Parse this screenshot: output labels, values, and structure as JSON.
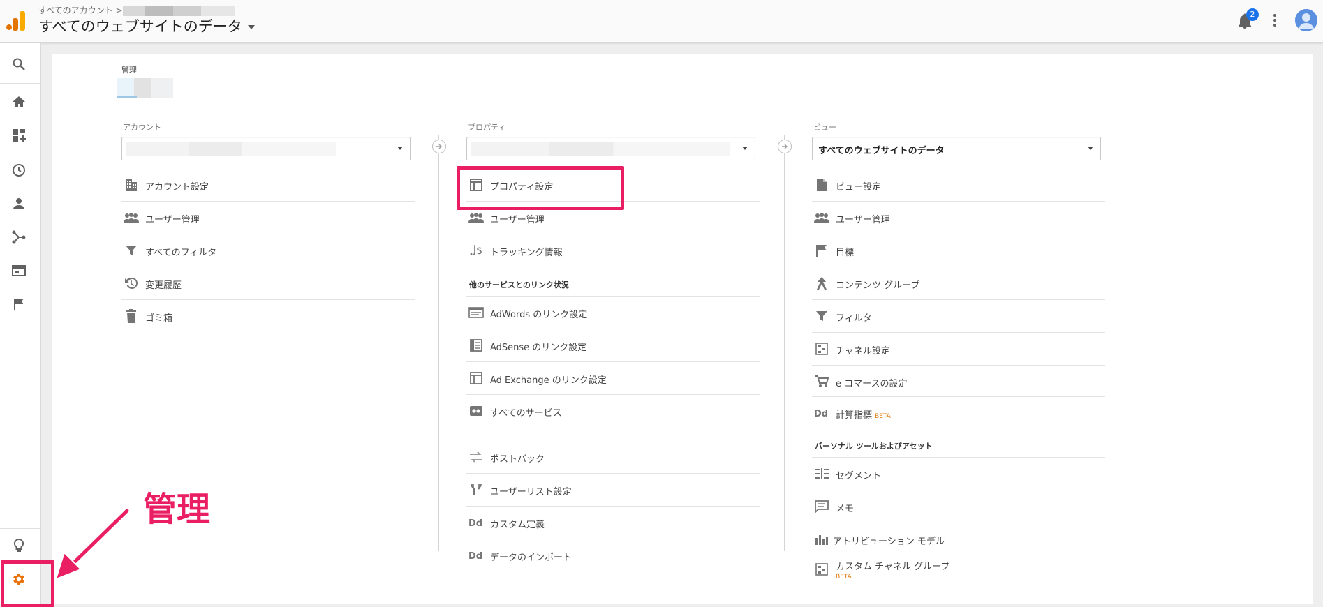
{
  "header": {
    "breadcrumb_prefix": "すべてのアカウント >",
    "site_title": "すべてのウェブサイトのデータ",
    "notification_count": "2"
  },
  "admin": {
    "label": "管理"
  },
  "account_col": {
    "label": "アカウント",
    "items": [
      "アカウント設定",
      "ユーザー管理",
      "すべてのフィルタ",
      "変更履歴",
      "ゴミ箱"
    ]
  },
  "property_col": {
    "label": "プロパティ",
    "items": [
      "プロパティ設定",
      "ユーザー管理",
      "トラッキング情報"
    ],
    "section_links": "他のサービスとのリンク状況",
    "links": [
      "AdWords のリンク設定",
      "AdSense のリンク設定",
      "Ad Exchange のリンク設定",
      "すべてのサービス"
    ],
    "more": [
      "ポストバック",
      "ユーザーリスト設定",
      "カスタム定義",
      "データのインポート"
    ]
  },
  "view_col": {
    "label": "ビュー",
    "selected": "すべてのウェブサイトのデータ",
    "items": [
      "ビュー設定",
      "ユーザー管理",
      "目標",
      "コンテンツ グループ",
      "フィルタ",
      "チャネル設定",
      "e コマースの設定",
      "計算指標"
    ],
    "beta": "BETA",
    "section_personal": "パーソナル ツールおよびアセット",
    "personal": [
      "セグメント",
      "メモ",
      "アトリビューション モデル",
      "カスタム チャネル グループ"
    ]
  },
  "annotation": {
    "callout": "管理"
  },
  "colors": {
    "accent": "#ea1e63",
    "ga_orange": "#f9ab00",
    "gear": "#e8710a"
  }
}
